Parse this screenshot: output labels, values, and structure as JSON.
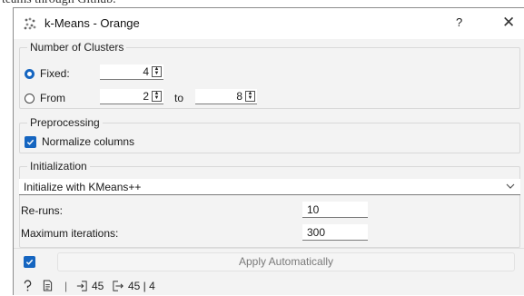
{
  "window": {
    "title": "k-Means - Orange",
    "help_label": "?",
    "close_label": "✕"
  },
  "clusters": {
    "group_title": "Number of Clusters",
    "fixed_label": "Fixed:",
    "fixed_value": "4",
    "from_label": "From",
    "from_value": "2",
    "to_label": "to",
    "to_value": "8",
    "selected": "fixed"
  },
  "preprocessing": {
    "group_title": "Preprocessing",
    "normalize_label": "Normalize columns",
    "normalize_checked": true
  },
  "initialization": {
    "group_title": "Initialization",
    "method_value": "Initialize with KMeans++",
    "reruns_label": "Re-runs:",
    "reruns_value": "10",
    "max_iter_label": "Maximum iterations:",
    "max_iter_value": "300"
  },
  "apply": {
    "auto_checked": true,
    "button_label": "Apply Automatically"
  },
  "status": {
    "input_count": "45",
    "output_count": "45 | 4"
  }
}
